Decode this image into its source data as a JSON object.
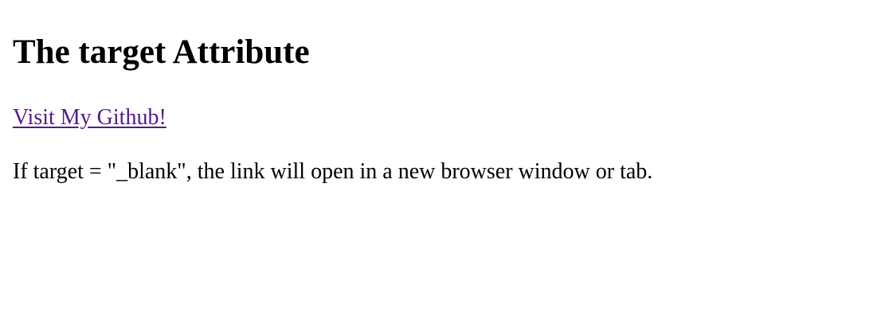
{
  "heading": "The target Attribute",
  "link": {
    "text": "Visit My Github!",
    "color": "#551a8b"
  },
  "description": "If target = \"_blank\", the link will open in a new browser window or tab."
}
